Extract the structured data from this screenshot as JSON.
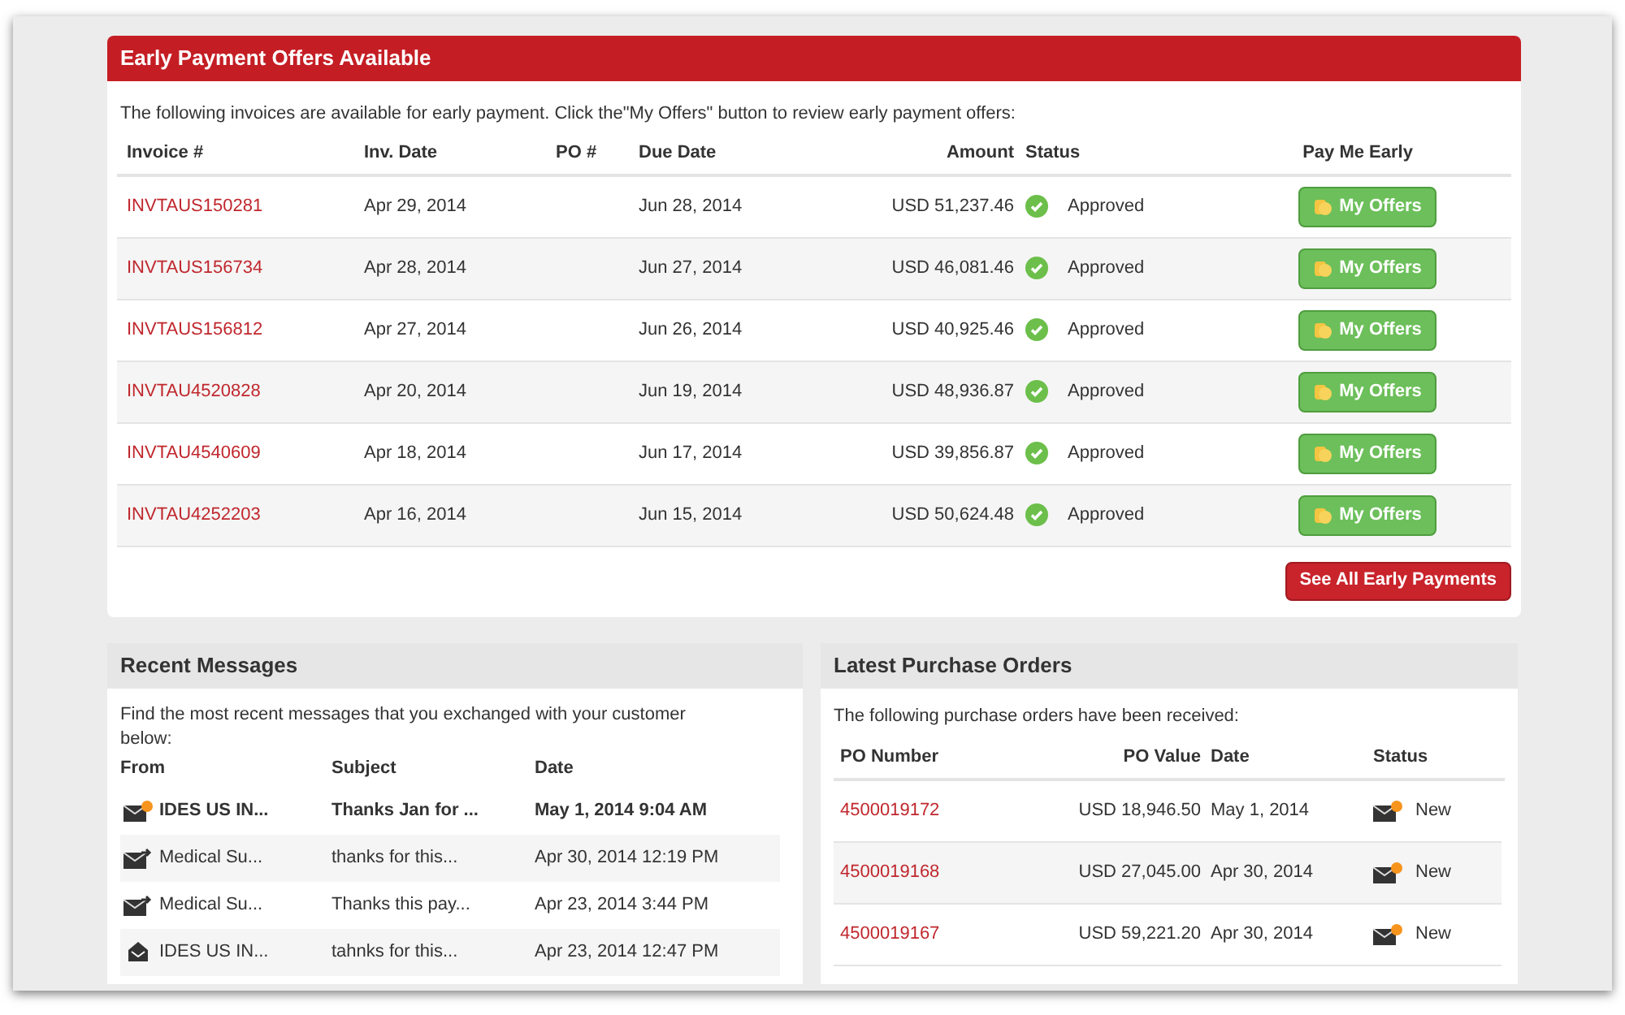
{
  "early_payments": {
    "title": "Early Payment Offers Available",
    "intro": "The following invoices are available for early payment. Click the\"My Offers\" button to review early payment offers:",
    "columns": [
      "Invoice #",
      "Inv. Date",
      "PO #",
      "Due Date",
      "Amount",
      "Status",
      "Pay Me Early"
    ],
    "rows": [
      {
        "invoice": "INVTAUS150281",
        "inv_date": "Apr 29, 2014",
        "due_date": "Jun 28, 2014",
        "amount": "USD 51,237.46",
        "status": "Approved",
        "action": "My Offers"
      },
      {
        "invoice": "INVTAUS156734",
        "inv_date": "Apr 28, 2014",
        "due_date": "Jun 27, 2014",
        "amount": "USD 46,081.46",
        "status": "Approved",
        "action": "My Offers"
      },
      {
        "invoice": "INVTAUS156812",
        "inv_date": "Apr 27, 2014",
        "due_date": "Jun 26, 2014",
        "amount": "USD 40,925.46",
        "status": "Approved",
        "action": "My Offers"
      },
      {
        "invoice": "INVTAU4520828",
        "inv_date": "Apr 20, 2014",
        "due_date": "Jun 19, 2014",
        "amount": "USD 48,936.87",
        "status": "Approved",
        "action": "My Offers"
      },
      {
        "invoice": "INVTAU4540609",
        "inv_date": "Apr 18, 2014",
        "due_date": "Jun 17, 2014",
        "amount": "USD 39,856.87",
        "status": "Approved",
        "action": "My Offers"
      },
      {
        "invoice": "INVTAU4252203",
        "inv_date": "Apr 16, 2014",
        "due_date": "Jun 15, 2014",
        "amount": "USD 50,624.48",
        "status": "Approved",
        "action": "My Offers"
      }
    ],
    "see_all_button": "See All Early Payments"
  },
  "recent_messages": {
    "title": "Recent Messages",
    "intro": "Find the most recent messages that you exchanged with your customer below:",
    "columns": [
      "From",
      "Subject",
      "Date"
    ],
    "rows": [
      {
        "kind": "new",
        "unread": true,
        "from": "IDES US IN...",
        "subject": "Thanks Jan for ...",
        "date": "May 1, 2014 9:04 AM"
      },
      {
        "kind": "sent",
        "unread": false,
        "from": "Medical Su...",
        "subject": "thanks for this...",
        "date": "Apr 30, 2014 12:19 PM"
      },
      {
        "kind": "sent",
        "unread": false,
        "from": "Medical Su...",
        "subject": "Thanks this pay...",
        "date": "Apr 23, 2014 3:44 PM"
      },
      {
        "kind": "opened",
        "unread": false,
        "from": "IDES US IN...",
        "subject": "tahnks for this...",
        "date": "Apr 23, 2014 12:47 PM"
      }
    ]
  },
  "purchase_orders": {
    "title": "Latest Purchase Orders",
    "intro": "The following purchase orders have been received:",
    "columns": [
      "PO Number",
      "PO Value",
      "Date",
      "Status"
    ],
    "rows": [
      {
        "po_number": "4500019172",
        "value": "USD 18,946.50",
        "date": "May 1, 2014",
        "status": "New"
      },
      {
        "po_number": "4500019168",
        "value": "USD 27,045.00",
        "date": "Apr 30, 2014",
        "status": "New"
      },
      {
        "po_number": "4500019167",
        "value": "USD 59,221.20",
        "date": "Apr 30, 2014",
        "status": "New"
      }
    ]
  }
}
